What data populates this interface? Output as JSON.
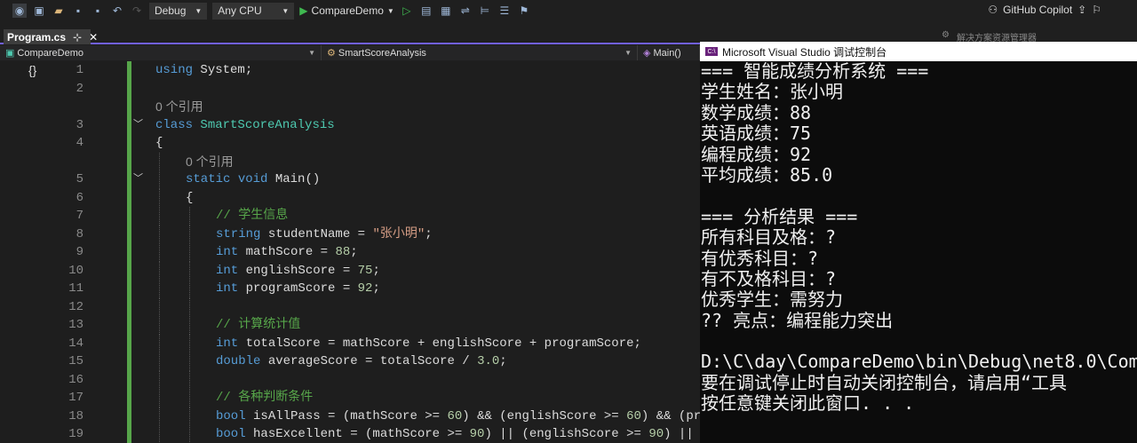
{
  "toolbar": {
    "config": "Debug",
    "platform": "Any CPU",
    "run_target": "CompareDemo",
    "copilot": "GitHub Copilot"
  },
  "tab": {
    "label": "Program.cs",
    "pin": "⊹",
    "close": "✕"
  },
  "nav": {
    "project": "CompareDemo",
    "class": "SmartScoreAnalysis",
    "member": "Main()"
  },
  "solution_explorer": {
    "title": "解决方案资源管理器"
  },
  "editor": {
    "rows": [
      {
        "n": "1",
        "indent": 0,
        "tokens": [
          [
            "kw",
            "using"
          ],
          [
            "tx",
            " System;"
          ]
        ]
      },
      {
        "n": "2",
        "indent": 0,
        "tokens": []
      },
      {
        "n": "",
        "indent": 0,
        "lens": "0 个引用"
      },
      {
        "n": "3",
        "indent": 0,
        "fold": true,
        "tokens": [
          [
            "kw",
            "class"
          ],
          [
            "tx",
            " "
          ],
          [
            "ty",
            "SmartScoreAnalysis"
          ]
        ]
      },
      {
        "n": "4",
        "indent": 0,
        "tokens": [
          [
            "tx",
            "{"
          ]
        ]
      },
      {
        "n": "",
        "indent": 1,
        "lens": "0 个引用"
      },
      {
        "n": "5",
        "indent": 1,
        "fold": true,
        "tokens": [
          [
            "kw",
            "static"
          ],
          [
            "tx",
            " "
          ],
          [
            "kw",
            "void"
          ],
          [
            "tx",
            " Main()"
          ]
        ]
      },
      {
        "n": "6",
        "indent": 1,
        "tokens": [
          [
            "tx",
            "{"
          ]
        ]
      },
      {
        "n": "7",
        "indent": 2,
        "tokens": [
          [
            "cm",
            "// 学生信息"
          ]
        ]
      },
      {
        "n": "8",
        "indent": 2,
        "tokens": [
          [
            "kw",
            "string"
          ],
          [
            "tx",
            " studentName = "
          ],
          [
            "st",
            "\"张小明\""
          ],
          [
            "tx",
            ";"
          ]
        ]
      },
      {
        "n": "9",
        "indent": 2,
        "tokens": [
          [
            "kw",
            "int"
          ],
          [
            "tx",
            " mathScore = "
          ],
          [
            "nu",
            "88"
          ],
          [
            "tx",
            ";"
          ]
        ]
      },
      {
        "n": "10",
        "indent": 2,
        "tokens": [
          [
            "kw",
            "int"
          ],
          [
            "tx",
            " englishScore = "
          ],
          [
            "nu",
            "75"
          ],
          [
            "tx",
            ";"
          ]
        ]
      },
      {
        "n": "11",
        "indent": 2,
        "tokens": [
          [
            "kw",
            "int"
          ],
          [
            "tx",
            " programScore = "
          ],
          [
            "nu",
            "92"
          ],
          [
            "tx",
            ";"
          ]
        ]
      },
      {
        "n": "12",
        "indent": 2,
        "tokens": []
      },
      {
        "n": "13",
        "indent": 2,
        "tokens": [
          [
            "cm",
            "// 计算统计值"
          ]
        ]
      },
      {
        "n": "14",
        "indent": 2,
        "tokens": [
          [
            "kw",
            "int"
          ],
          [
            "tx",
            " totalScore = mathScore + englishScore + programScore;"
          ]
        ]
      },
      {
        "n": "15",
        "indent": 2,
        "tokens": [
          [
            "kw",
            "double"
          ],
          [
            "tx",
            " averageScore = totalScore / "
          ],
          [
            "nu",
            "3.0"
          ],
          [
            "tx",
            ";"
          ]
        ]
      },
      {
        "n": "16",
        "indent": 2,
        "tokens": []
      },
      {
        "n": "17",
        "indent": 2,
        "tokens": [
          [
            "cm",
            "// 各种判断条件"
          ]
        ]
      },
      {
        "n": "18",
        "indent": 2,
        "tokens": [
          [
            "kw",
            "bool"
          ],
          [
            "tx",
            " isAllPass = (mathScore >= "
          ],
          [
            "nu",
            "60"
          ],
          [
            "tx",
            ") && (englishScore >= "
          ],
          [
            "nu",
            "60"
          ],
          [
            "tx",
            ") && (pr"
          ]
        ]
      },
      {
        "n": "19",
        "indent": 2,
        "tokens": [
          [
            "kw",
            "bool"
          ],
          [
            "tx",
            " hasExcellent = (mathScore >= "
          ],
          [
            "nu",
            "90"
          ],
          [
            "tx",
            ") || (englishScore >= "
          ],
          [
            "nu",
            "90"
          ],
          [
            "tx",
            ") ||"
          ]
        ]
      }
    ]
  },
  "console": {
    "title": "Microsoft Visual Studio 调试控制台",
    "lines": [
      "=== 智能成绩分析系统 ===",
      "学生姓名：张小明",
      "数学成绩：88",
      "英语成绩：75",
      "编程成绩：92",
      "平均成绩：85.0",
      "",
      "=== 分析结果 ===",
      "所有科目及格：?",
      "有优秀科目：?",
      "有不及格科目：?",
      "优秀学生：需努力",
      "?? 亮点：编程能力突出",
      "",
      "D:\\C\\day\\CompareDemo\\bin\\Debug\\net8.0\\Com",
      "要在调试停止时自动关闭控制台，请启用“工具",
      "按任意键关闭此窗口. . ."
    ]
  }
}
